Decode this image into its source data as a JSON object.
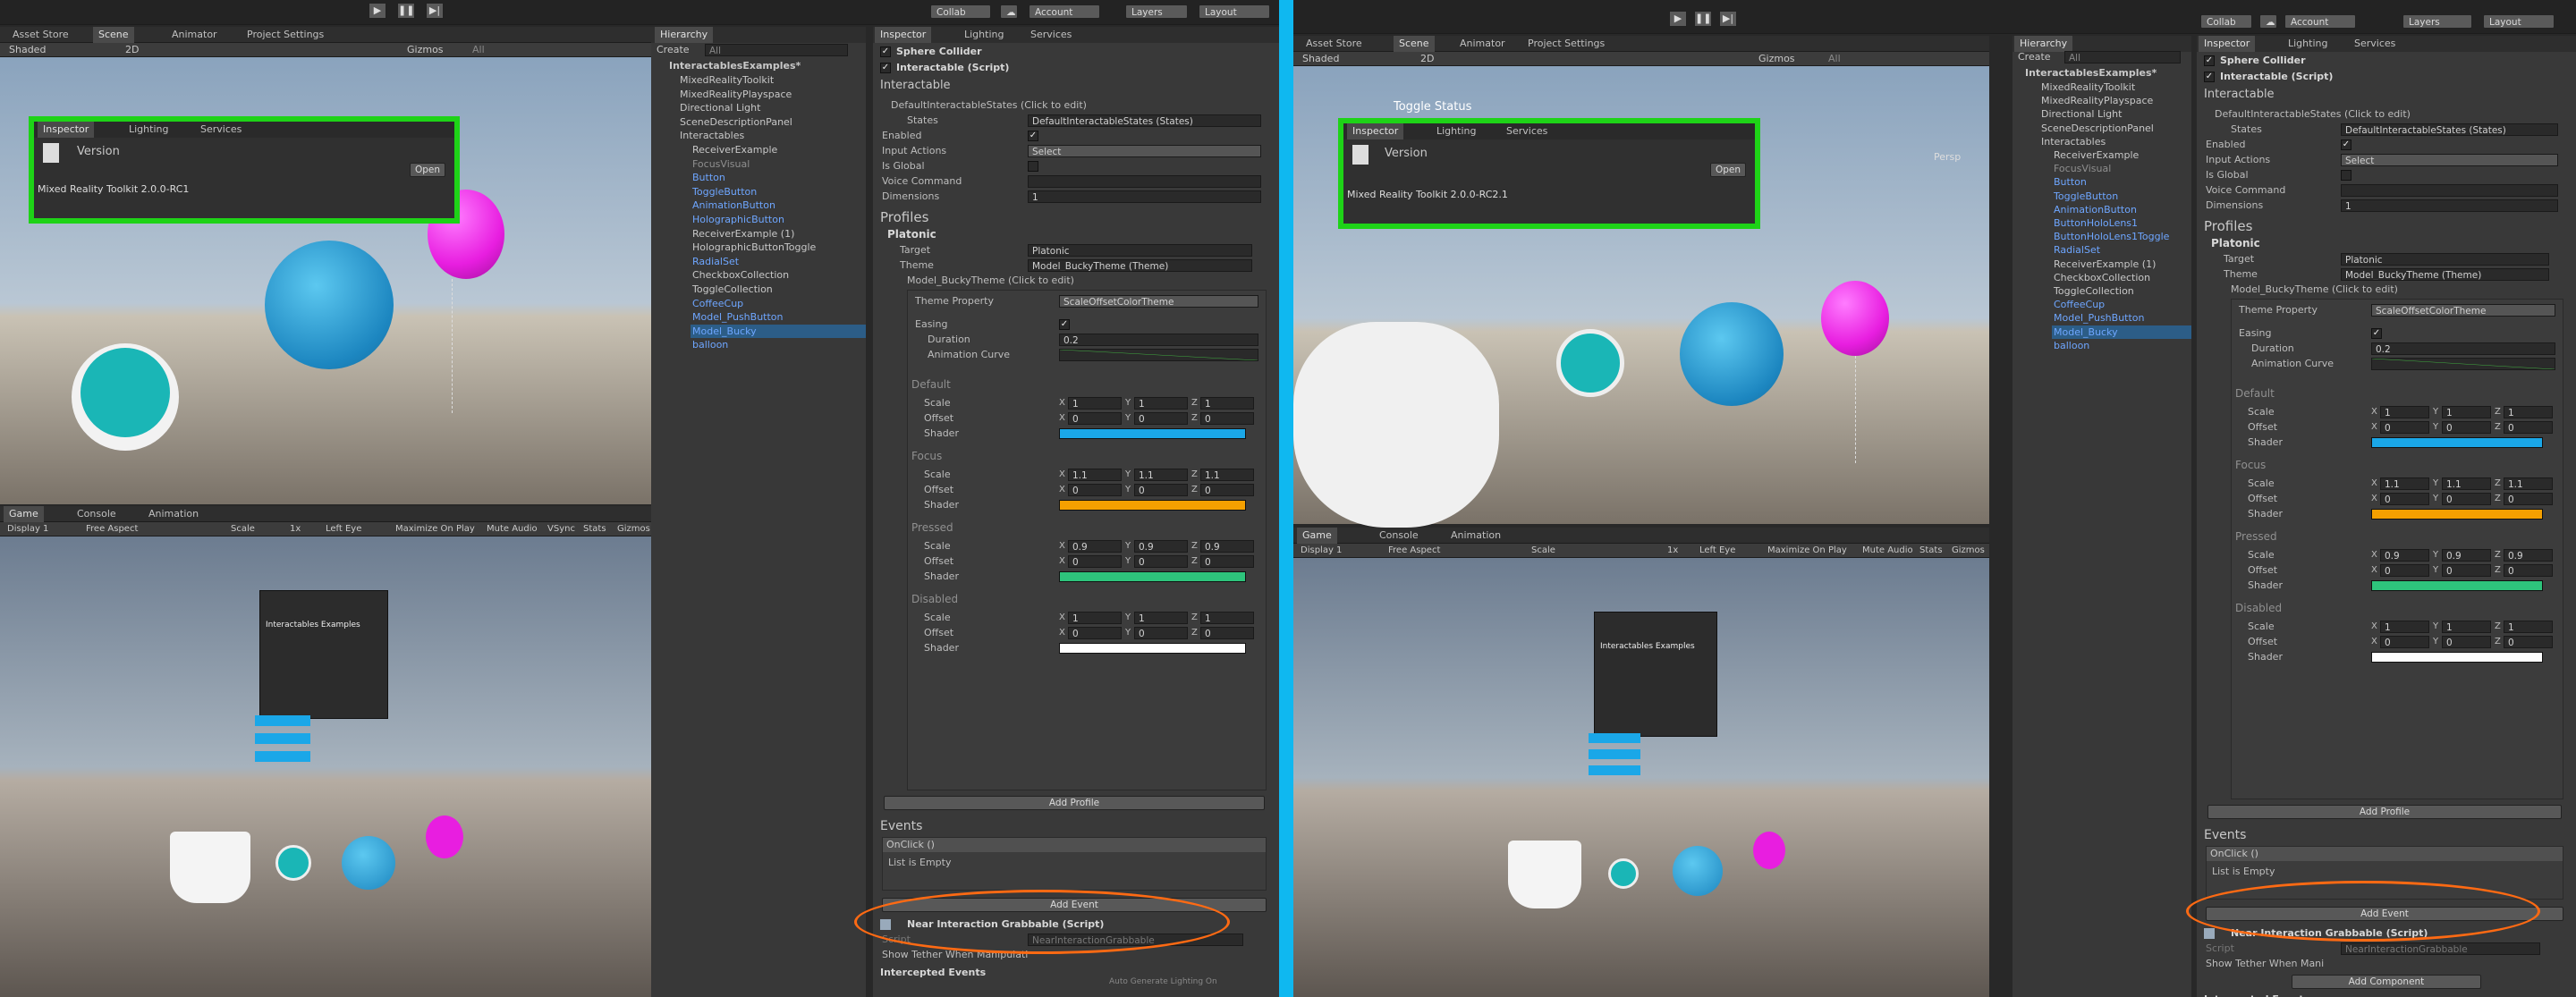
{
  "colors": {
    "highlight_green": "#1ed317",
    "annotation_orange": "#ff6a13",
    "divider_cyan": "#0fb8f0",
    "shader_focus": "#f5a000",
    "shader_pressed": "#2ec47c",
    "shader_default": "#1aa7e8",
    "shader_disabled": "#ffffff"
  },
  "left": {
    "toolbar": {
      "asset_store": "Asset Store",
      "scene_tab": "Scene",
      "animator_tab": "Animator",
      "project_settings": "Project Settings",
      "collab": "Collab",
      "account": "Account",
      "layers": "Layers",
      "layout": "Layout",
      "shaded": "Shaded",
      "mode2d": "2D",
      "gizmos": "Gizmos",
      "search_all": "All"
    },
    "hierarchy": {
      "title": "Hierarchy",
      "create": "Create",
      "search": "All",
      "root": "InteractablesExamples*",
      "items": [
        "MixedRealityToolkit",
        "MixedRealityPlayspace",
        "Directional Light",
        "SceneDescriptionPanel",
        "Interactables",
        "ReceiverExample",
        "FocusVisual",
        "Button",
        "ToggleButton",
        "AnimationButton",
        "HolographicButton",
        "ReceiverExample (1)",
        "HolographicButtonToggle",
        "RadialSet",
        "CheckboxCollection",
        "ToggleCollection",
        "CoffeeCup",
        "Model_PushButton",
        "Model_Bucky",
        "balloon"
      ]
    },
    "overlay": {
      "tab_inspector": "Inspector",
      "tab_lighting": "Lighting",
      "tab_services": "Services",
      "version": "Version",
      "open": "Open",
      "text": "Mixed Reality Toolkit 2.0.0-RC1"
    },
    "game": {
      "tab_game": "Game",
      "tab_console": "Console",
      "tab_animation": "Animation",
      "display": "Display 1",
      "aspect": "Free Aspect",
      "scale": "Scale",
      "scale_val": "1x",
      "left_eye": "Left Eye",
      "maximize": "Maximize On Play",
      "mute": "Mute Audio",
      "vsync": "VSync",
      "stats": "Stats",
      "gizmos": "Gizmos",
      "panel_title": "Interactables Examples"
    },
    "inspector": {
      "tab_inspector": "Inspector",
      "tab_lighting": "Lighting",
      "tab_services": "Services",
      "sphere_collider": "Sphere Collider",
      "interactable_script": "Interactable (Script)",
      "interactable": "Interactable",
      "default_states": "DefaultInteractableStates (Click to edit)",
      "states_label": "States",
      "states_val": "DefaultInteractableStates (States)",
      "enabled": "Enabled",
      "input_actions": "Input Actions",
      "input_val": "Select",
      "is_global": "Is Global",
      "voice_command": "Voice Command",
      "dimensions": "Dimensions",
      "dimensions_val": "1",
      "profiles": "Profiles",
      "platonic": "Platonic",
      "target": "Target",
      "target_val": "Platonic",
      "theme": "Theme",
      "theme_val": "Model_BuckyTheme (Theme)",
      "bucky_theme": "Model_BuckyTheme (Click to edit)",
      "theme_property": "Theme Property",
      "theme_property_val": "ScaleOffsetColorTheme",
      "easing": "Easing",
      "duration": "Duration",
      "duration_val": "0.2",
      "animation_curve": "Animation Curve",
      "states": [
        {
          "name": "Default",
          "scale": [
            "1",
            "1",
            "1"
          ],
          "offset": [
            "0",
            "0",
            "0"
          ]
        },
        {
          "name": "Focus",
          "scale": [
            "1.1",
            "1.1",
            "1.1"
          ],
          "offset": [
            "0",
            "0",
            "0"
          ]
        },
        {
          "name": "Pressed",
          "scale": [
            "0.9",
            "0.9",
            "0.9"
          ],
          "offset": [
            "0",
            "0",
            "0"
          ]
        },
        {
          "name": "Disabled",
          "scale": [
            "1",
            "1",
            "1"
          ],
          "offset": [
            "0",
            "0",
            "0"
          ]
        }
      ],
      "scale": "Scale",
      "offset": "Offset",
      "shader": "Shader",
      "x": "X",
      "y": "Y",
      "z": "Z",
      "add_profile": "Add Profile",
      "events": "Events",
      "onclick": "OnClick ()",
      "list_empty": "List is Empty",
      "add_event": "Add Event",
      "grabbable": "Near Interaction Grabbable (Script)",
      "script": "Script",
      "script_val": "NearInteractionGrabbable",
      "tether": "Show Tether When Manipulati",
      "intercepted": "Intercepted Events",
      "auto_generate": "Auto Generate Lighting On"
    }
  },
  "right": {
    "toolbar": {
      "asset_store": "Asset Store",
      "scene_tab": "Scene",
      "animator_tab": "Animator",
      "project_settings": "Project Settings",
      "collab": "Collab",
      "account": "Account",
      "layers": "Layers",
      "layout": "Layout",
      "shaded": "Shaded",
      "mode2d": "2D",
      "gizmos": "Gizmos",
      "search_all": "All",
      "persp": "Persp",
      "toggle_status": "Toggle Status"
    },
    "hierarchy": {
      "title": "Hierarchy",
      "create": "Create",
      "search": "All",
      "root": "InteractablesExamples*",
      "items": [
        "MixedRealityToolkit",
        "MixedRealityPlayspace",
        "Directional Light",
        "SceneDescriptionPanel",
        "Interactables",
        "ReceiverExample",
        "FocusVisual",
        "Button",
        "ToggleButton",
        "AnimationButton",
        "ButtonHoloLens1",
        "ButtonHoloLens1Toggle",
        "RadialSet",
        "ReceiverExample (1)",
        "CheckboxCollection",
        "ToggleCollection",
        "CoffeeCup",
        "Model_PushButton",
        "Model_Bucky",
        "balloon"
      ]
    },
    "overlay": {
      "tab_inspector": "Inspector",
      "tab_lighting": "Lighting",
      "tab_services": "Services",
      "version": "Version",
      "open": "Open",
      "text": "Mixed Reality Toolkit 2.0.0-RC2.1"
    },
    "game": {
      "tab_game": "Game",
      "tab_console": "Console",
      "tab_animation": "Animation",
      "display": "Display 1",
      "aspect": "Free Aspect",
      "scale": "Scale",
      "scale_val": "1x",
      "left_eye": "Left Eye",
      "maximize": "Maximize On Play",
      "mute": "Mute Audio",
      "stats": "Stats",
      "gizmos": "Gizmos",
      "panel_title": "Interactables Examples"
    },
    "inspector": {
      "tab_inspector": "Inspector",
      "tab_lighting": "Lighting",
      "tab_services": "Services",
      "sphere_collider": "Sphere Collider",
      "interactable_script": "Interactable (Script)",
      "interactable": "Interactable",
      "default_states": "DefaultInteractableStates (Click to edit)",
      "states_label": "States",
      "states_val": "DefaultInteractableStates (States)",
      "enabled": "Enabled",
      "input_actions": "Input Actions",
      "input_val": "Select",
      "is_global": "Is Global",
      "voice_command": "Voice Command",
      "dimensions": "Dimensions",
      "dimensions_val": "1",
      "profiles": "Profiles",
      "platonic": "Platonic",
      "target": "Target",
      "target_val": "Platonic",
      "theme": "Theme",
      "theme_val": "Model_BuckyTheme (Theme)",
      "bucky_theme": "Model_BuckyTheme (Click to edit)",
      "theme_property": "Theme Property",
      "theme_property_val": "ScaleOffsetColorTheme",
      "easing": "Easing",
      "duration": "Duration",
      "duration_val": "0.2",
      "animation_curve": "Animation Curve",
      "states": [
        {
          "name": "Default",
          "scale": [
            "1",
            "1",
            "1"
          ],
          "offset": [
            "0",
            "0",
            "0"
          ]
        },
        {
          "name": "Focus",
          "scale": [
            "1.1",
            "1.1",
            "1.1"
          ],
          "offset": [
            "0",
            "0",
            "0"
          ]
        },
        {
          "name": "Pressed",
          "scale": [
            "0.9",
            "0.9",
            "0.9"
          ],
          "offset": [
            "0",
            "0",
            "0"
          ]
        },
        {
          "name": "Disabled",
          "scale": [
            "1",
            "1",
            "1"
          ],
          "offset": [
            "0",
            "0",
            "0"
          ]
        }
      ],
      "scale": "Scale",
      "offset": "Offset",
      "shader": "Shader",
      "x": "X",
      "y": "Y",
      "z": "Z",
      "add_profile": "Add Profile",
      "events": "Events",
      "onclick": "OnClick ()",
      "list_empty": "List is Empty",
      "add_event": "Add Event",
      "grabbable": "Near Interaction Grabbable (Script)",
      "script": "Script",
      "script_val": "NearInteractionGrabbable",
      "tether": "Show Tether When Mani",
      "add_component": "Add Component",
      "intercepted": "Intercepted Events"
    }
  }
}
